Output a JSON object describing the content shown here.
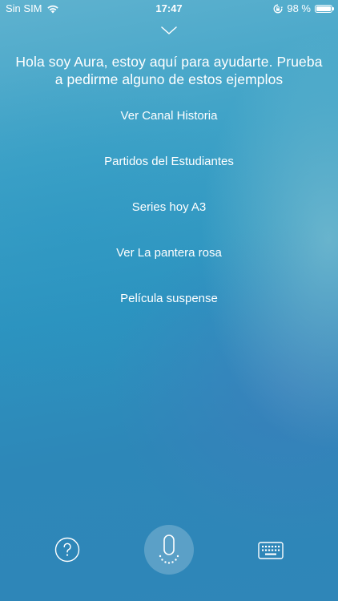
{
  "status_bar": {
    "carrier": "Sin SIM",
    "time": "17:47",
    "battery_text": "98 %",
    "battery_level": 0.98
  },
  "assistant": {
    "greeting_line1": "Hola soy Aura, estoy aquí para ayudarte. Prueba",
    "greeting_line2": "a pedirme alguno de estos ejemplos"
  },
  "suggestions": [
    "Ver Canal Historia",
    "Partidos del Estudiantes",
    "Series hoy A3",
    "Ver La pantera rosa",
    "Película suspense"
  ],
  "icons": {
    "collapse": "chevron-down-icon",
    "help": "help-icon",
    "mic": "microphone-icon",
    "keyboard": "keyboard-icon",
    "wifi": "wifi-icon",
    "orientation_lock": "orientation-lock-icon",
    "battery": "battery-icon"
  }
}
